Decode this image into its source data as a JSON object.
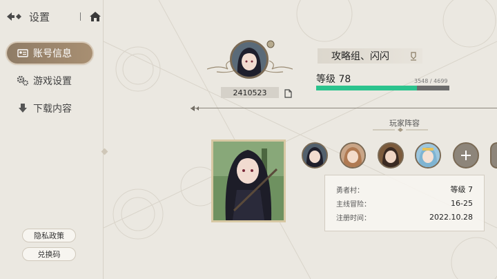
{
  "header": {
    "title": "设置"
  },
  "menu": [
    {
      "label": "账号信息",
      "icon": "id-card-icon",
      "active": true
    },
    {
      "label": "游戏设置",
      "icon": "gears-icon",
      "active": false
    },
    {
      "label": "下载内容",
      "icon": "download-icon",
      "active": false
    }
  ],
  "buttons": {
    "privacy": "隐私政策",
    "redeem": "兑换码"
  },
  "profile": {
    "uid": "2410523",
    "name": "攻略组、闪闪",
    "level_label": "等级 78",
    "exp_text": "3548 / 4699",
    "exp_current": 3548,
    "exp_max": 4699
  },
  "lineup": {
    "title": "玩家阵容"
  },
  "info": [
    {
      "label": "勇者村：",
      "value": "等级 7"
    },
    {
      "label": "主线冒险：",
      "value": "16-25"
    },
    {
      "label": "注册时间：",
      "value": "2022.10.28"
    }
  ],
  "colors": {
    "exp_fill": "#2bc38d",
    "active_tab": "#9a8469"
  }
}
